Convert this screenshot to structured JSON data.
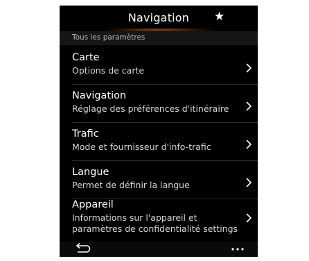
{
  "header": {
    "title": "Navigation",
    "favorite_icon": "star-icon",
    "favorite_glyph": "★"
  },
  "section": {
    "label": "Tous les paramètres"
  },
  "menu": {
    "items": [
      {
        "title": "Carte",
        "subtitle": "Options de carte",
        "icon": "chevron-right-icon"
      },
      {
        "title": "Navigation",
        "subtitle": "Réglage des préférences d'itinéraire",
        "icon": "chevron-right-icon"
      },
      {
        "title": "Trafic",
        "subtitle": "Mode et fournisseur d'info-trafic",
        "icon": "chevron-right-icon"
      },
      {
        "title": "Langue",
        "subtitle": "Permet de définir la langue",
        "icon": "chevron-right-icon"
      },
      {
        "title": "Appareil",
        "subtitle": "Informations sur l'appareil et",
        "subtitle_line2": "paramètres de confidentialité settings",
        "icon": "chevron-right-icon"
      }
    ]
  },
  "bottom_bar": {
    "back_icon": "back-arrow-icon",
    "more_icon": "more-dots-icon"
  },
  "colors": {
    "background": "#000000",
    "text": "#ffffff",
    "subtext": "#d6d6d6",
    "accent_glow": "#dc781e"
  }
}
